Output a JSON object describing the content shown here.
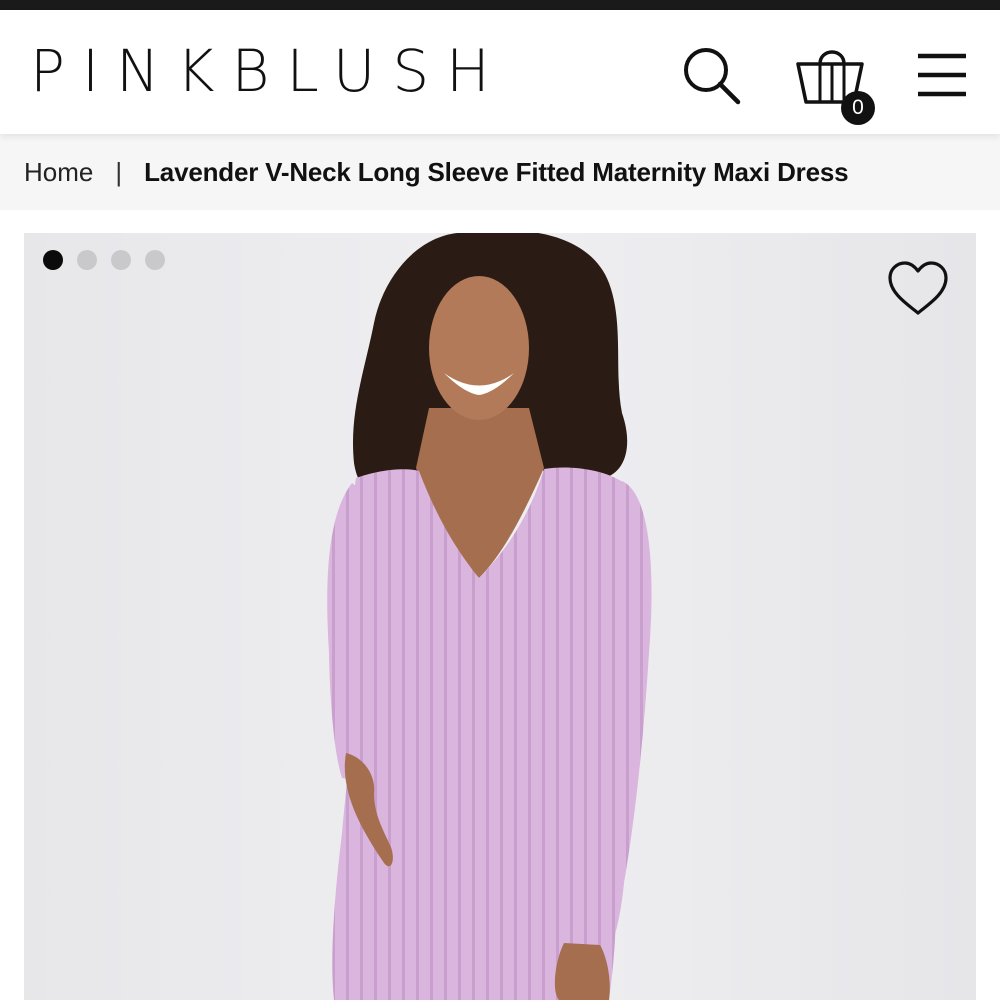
{
  "brand": {
    "logo_text": "PINKBLUSH"
  },
  "header": {
    "icons": [
      "search-icon",
      "shopping-bag-icon",
      "hamburger-menu-icon"
    ],
    "cart_count": "0"
  },
  "breadcrumb": {
    "home": "Home",
    "separator": "|",
    "current": "Lavender V-Neck Long Sleeve Fitted Maternity Maxi Dress"
  },
  "gallery": {
    "image_count": 4,
    "active_index": 0,
    "favorite_icon": "heart-outline-icon",
    "colors": {
      "background": "#ececef",
      "dress": "#d9b2dc",
      "active_dot": "#0b0b0b",
      "inactive_dot": "#c9c9cc"
    }
  }
}
